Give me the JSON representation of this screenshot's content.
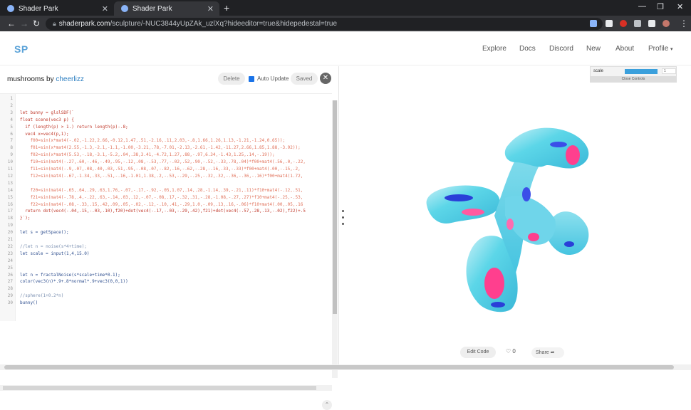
{
  "browser": {
    "tabs": [
      {
        "label": "Shader Park",
        "active": false
      },
      {
        "label": "Shader Park",
        "active": true
      }
    ],
    "url_host": "shaderpark.com",
    "url_path": "/sculpture/-NUC3844yUpZAk_uzlXq?hideeditor=true&hidepedestal=true"
  },
  "site": {
    "logo": "SP",
    "nav": [
      "Explore",
      "Docs",
      "Discord",
      "New",
      "About",
      "Profile"
    ]
  },
  "editor": {
    "title": "mushrooms",
    "by": "by",
    "author": "cheerlizz",
    "delete_label": "Delete",
    "auto_update_label": "Auto Update",
    "saved_label": "Saved",
    "lines": [
      {
        "n": "1",
        "t": "",
        "c": "pl"
      },
      {
        "n": "2",
        "t": "",
        "c": "pl"
      },
      {
        "n": "3",
        "t": "let bunny = glslSDF(`",
        "c": "kw"
      },
      {
        "n": "4",
        "t": "float scene(vec3 p) {",
        "c": "kw"
      },
      {
        "n": "5",
        "t": "  if (length(p) > 1.) return length(p)-.8;",
        "c": "kw"
      },
      {
        "n": "6",
        "t": "  vec4 x=vec4(p,1);",
        "c": "kw"
      },
      {
        "n": "7",
        "t": "    f00=sin(x*mat4(-.02,-1.22,2.66,-0.12,1.47,.51,-2.16,.11,2.03,-.8,1.66,1.26,1.13,-1.21,-1.24,0.65));",
        "c": "str"
      },
      {
        "n": "8",
        "t": "    f01=sin(x*mat4(2.55,-1.3,-2.1,-1.1,-1.00,-3.21,.78,-7.01,-2.13,-2.61,-1.42,-11.27,2.66,1.85,1.88,-3.92));",
        "c": "str"
      },
      {
        "n": "9",
        "t": "    f02=sin(x*mat4(5.53,-.18,-3.1,-5.2,.04,.38,3.41,-4.72,1.27,.88,-.97,6.34,-1.43,1.25,.14,-.19));",
        "c": "str"
      },
      {
        "n": "10",
        "t": "    f10=sin(mat4(-.27,.60,-.46,-.49,.95,-.12,.08,-.53,.77,-.02,.52,.90,-.52,-.33,.78,.04)*f00+mat4(.56,.0,-.22,",
        "c": "str"
      },
      {
        "n": "11",
        "t": "    f11=sin(mat4(-.9,.07,.08,.40,.03,.51,.95,-.08,.07,-.82,.16,-.62,-.28,-.16,.33,-.33)*f00+mat4(.00,-.15,.2,",
        "c": "str"
      },
      {
        "n": "12",
        "t": "    f12=sin(mat4(-.67,-1.34,.33,-.51,-.16,-1.01,1.38,.2,-.53,-.29,-.25,-.32,.32,-.36,-.36,-.16)*f00+mat4(1.72,",
        "c": "str"
      },
      {
        "n": "13",
        "t": "",
        "c": "pl"
      },
      {
        "n": "14",
        "t": "    f20=sin(mat4(-.65,.64,.29,.63,1.76,-.07,-.17,-.92,-.05,1.07,.14,.28,-1.14,.39,-.21,.11)*f10+mat4(-.12,.51,",
        "c": "str"
      },
      {
        "n": "15",
        "t": "    f21=sin(mat4(-.78,.4,-.22,.63,-.14,.03,.12,-.07,-.08,.17,-.32,.31,-.28,-1.08,-.27,.27)*f10+mat4(-.25,-.53,",
        "c": "str"
      },
      {
        "n": "16",
        "t": "    f22=sin(mat4(-.08,-.33,.15,.42,.09,.05,-.02,-.12,-.10,.41,-.29,1.0,-.09,.13,.16,-.06)*f10+mat4(.00,.05,.16",
        "c": "str"
      },
      {
        "n": "17",
        "t": "  return dot(vec4(-.04,.15,-.03,.10),f20)+dot(vec4(-.17,-.03,-.29,.42),f21)+dot(vec4(-.57,.28,.13,-.02),f22)+.5",
        "c": "kw"
      },
      {
        "n": "18",
        "t": "}`);",
        "c": "kw"
      },
      {
        "n": "19",
        "t": "",
        "c": "pl"
      },
      {
        "n": "20",
        "t": "let s = getSpace();",
        "c": "fn"
      },
      {
        "n": "21",
        "t": "",
        "c": "pl"
      },
      {
        "n": "22",
        "t": "//let n = noise(s*4+time);",
        "c": "cm"
      },
      {
        "n": "23",
        "t": "let scale = input(1,4,15.0)",
        "c": "fn"
      },
      {
        "n": "24",
        "t": "",
        "c": "pl"
      },
      {
        "n": "25",
        "t": "",
        "c": "pl"
      },
      {
        "n": "26",
        "t": "let n = fractalNoise(s*scale+time*0.1);",
        "c": "fn"
      },
      {
        "n": "27",
        "t": "color(vec3(n)*.9+.8*normal*.9+vec3(0,0,1))",
        "c": "fn"
      },
      {
        "n": "28",
        "t": "",
        "c": "pl"
      },
      {
        "n": "29",
        "t": "//sphere(1+0.2*n)",
        "c": "cm"
      },
      {
        "n": "30",
        "t": "bunny()",
        "c": "fn"
      }
    ]
  },
  "viewer": {
    "control_label": "scale",
    "control_value": "1",
    "close_controls_label": "Close Controls",
    "scale_fraction": 0.62,
    "edit_code_label": "Edit Code",
    "likes": "0",
    "share_label": "Share"
  },
  "colors": {
    "accent": "#3ba0dc",
    "logo": "#5aa2d8",
    "sculpture_cyan": "#5cd6e8",
    "sculpture_pink": "#ff3f8e",
    "sculpture_blue": "#2a3fd8"
  }
}
